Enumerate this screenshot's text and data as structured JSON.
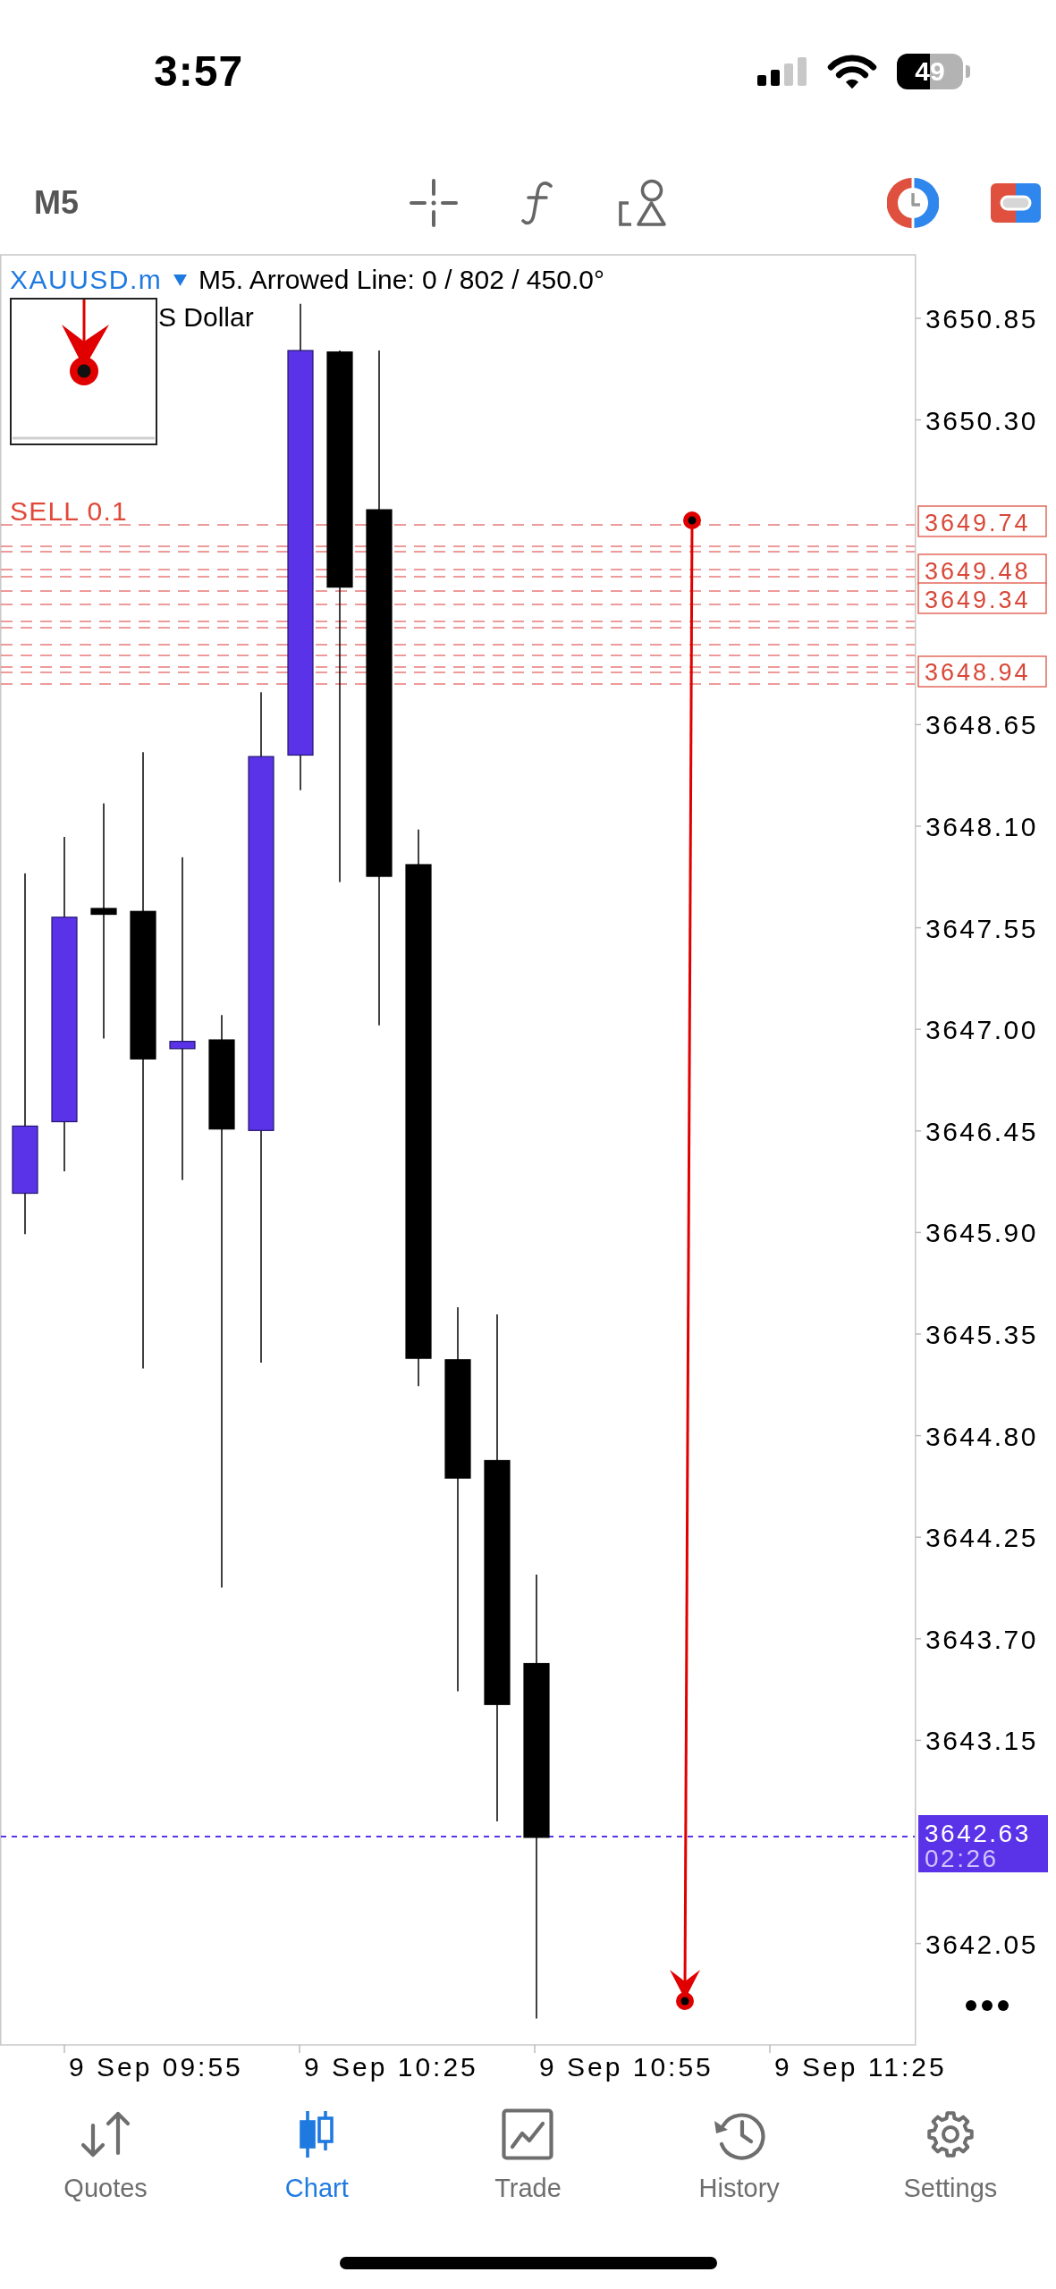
{
  "status_bar": {
    "time": "3:57",
    "battery": "49"
  },
  "toolbar": {
    "timeframe": "M5"
  },
  "chart": {
    "symbol": "XAUUSD.m",
    "info": "M5. Arrowed Line: 0 / 802 / 450.0°",
    "legend": "S Dollar",
    "price_axis": [
      "3650.85",
      "3650.30",
      "3648.65",
      "3648.10",
      "3647.55",
      "3647.00",
      "3646.45",
      "3645.90",
      "3645.35",
      "3644.80",
      "3644.25",
      "3643.70",
      "3643.15",
      "3642.05"
    ],
    "orders": [
      {
        "label": "SELL 0.1",
        "price": "3649.74"
      },
      {
        "price": "3649.48"
      },
      {
        "price": "3649.34"
      },
      {
        "price": "3648.94"
      }
    ],
    "current_price": {
      "price": "3642.63",
      "countdown": "02:26"
    },
    "time_axis": [
      "9 Sep 09:55",
      "9 Sep 10:25",
      "9 Sep 10:55",
      "9 Sep 11:25"
    ]
  },
  "tabs": [
    {
      "label": "Quotes",
      "selected": false
    },
    {
      "label": "Chart",
      "selected": true
    },
    {
      "label": "Trade",
      "selected": false
    },
    {
      "label": "History",
      "selected": false
    },
    {
      "label": "Settings",
      "selected": false
    }
  ]
}
